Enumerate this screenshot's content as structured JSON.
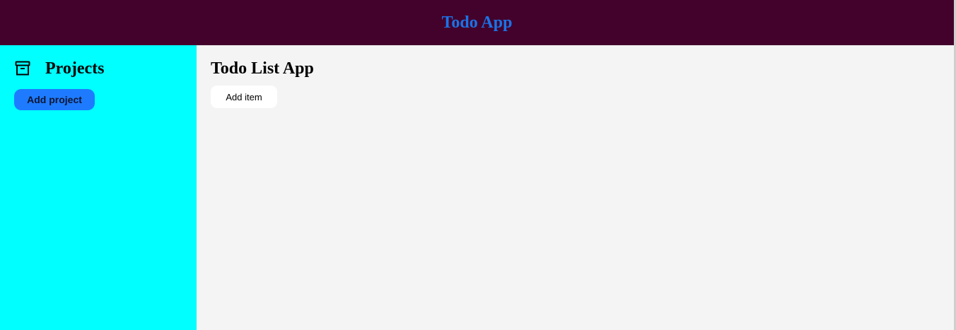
{
  "header": {
    "title": "Todo App"
  },
  "sidebar": {
    "icon": "archive-icon",
    "title": "Projects",
    "add_project_label": "Add project"
  },
  "main": {
    "title": "Todo List App",
    "add_item_label": "Add item"
  },
  "colors": {
    "header_bg": "#43022b",
    "header_title": "#1a73e8",
    "sidebar_bg": "#00ffff",
    "main_bg": "#f4f4f4",
    "add_project_bg": "#1e7bff",
    "add_item_bg": "#ffffff"
  }
}
